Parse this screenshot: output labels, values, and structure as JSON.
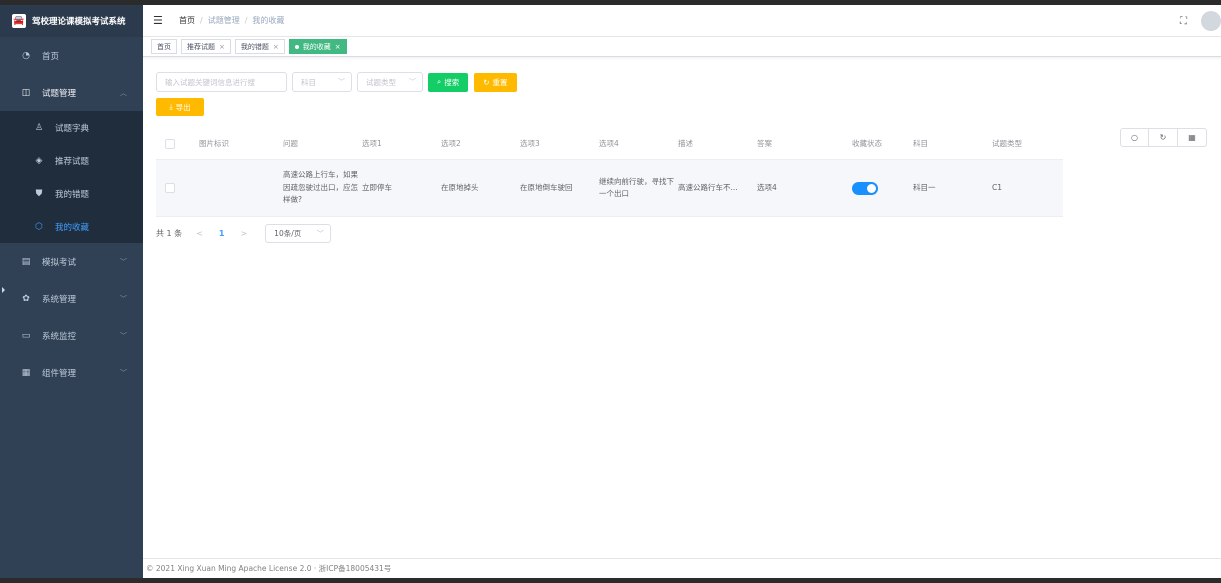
{
  "app": {
    "title": "驾校理论课模拟考试系统"
  },
  "sidebar": {
    "home": "首页",
    "question_mgmt": "试题管理",
    "sub": {
      "dict": "试题字典",
      "recommend": "推荐试题",
      "wrong": "我的错题",
      "fav": "我的收藏"
    },
    "exam": "模拟考试",
    "system": "系统管理",
    "monitor": "系统监控",
    "component": "组件管理"
  },
  "breadcrumb": [
    "首页",
    "试题管理",
    "我的收藏"
  ],
  "tags": [
    {
      "label": "首页"
    },
    {
      "label": "推荐试题"
    },
    {
      "label": "我的错题"
    },
    {
      "label": "我的收藏"
    }
  ],
  "search": {
    "keyword_placeholder": "输入试题关键词信息进行搜",
    "subject_placeholder": "科目",
    "type_placeholder": "试题类型",
    "search_label": "搜索",
    "reset_label": "重置",
    "export_label": "导出"
  },
  "table": {
    "headers": {
      "img": "图片标识",
      "question": "问题",
      "o1": "选项1",
      "o2": "选项2",
      "o3": "选项3",
      "o4": "选项4",
      "desc": "描述",
      "answer": "答案",
      "fav": "收藏状态",
      "subject": "科目",
      "type": "试题类型"
    },
    "rows": [
      {
        "question": "高速公路上行车，如果因疏忽驶过出口，应怎样做?",
        "o1": "立即停车",
        "o2": "在原地掉头",
        "o3": "在原地倒车驶回",
        "o4": "继续向前行驶，寻找下一个出口",
        "desc": "高速公路行车不...",
        "answer": "选项4",
        "subject": "科目一",
        "type": "C1",
        "favorited": true
      }
    ]
  },
  "pagination": {
    "total": "共 1 条",
    "prev": "<",
    "page": "1",
    "next": ">",
    "size": "10条/页"
  },
  "footer": "© 2021 Xing Xuan Ming Apache License 2.0 · 浙ICP备18005431号",
  "colors": {
    "sidebar": "#304156",
    "active_tag": "#42b983",
    "primary": "#409eff",
    "switch": "#1890ff",
    "search_btn": "#13ce66",
    "reset_btn": "#ffba00"
  }
}
